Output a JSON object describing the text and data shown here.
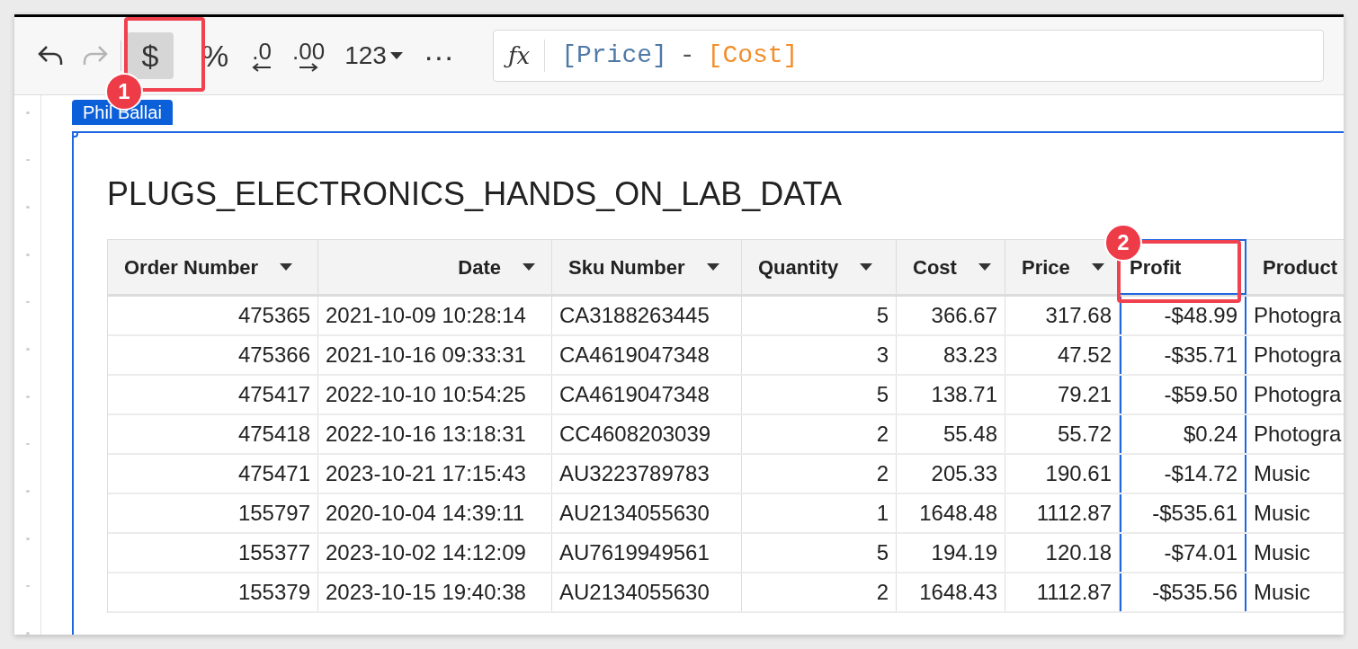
{
  "toolbar": {
    "buttons": [
      {
        "kind": "undo",
        "disabled": false,
        "selected": false
      },
      {
        "kind": "redo",
        "disabled": true,
        "selected": false
      },
      {
        "kind": "text",
        "label": "$",
        "disabled": false,
        "selected": true
      },
      {
        "kind": "text",
        "label": "%",
        "disabled": false,
        "selected": false
      },
      {
        "kind": "decrease_decimals",
        "label": ".0",
        "disabled": false,
        "selected": false
      },
      {
        "kind": "increase_decimals",
        "label": ".00",
        "disabled": false,
        "selected": false
      },
      {
        "kind": "dropdown",
        "label": "123",
        "disabled": false,
        "selected": false
      },
      {
        "kind": "text",
        "label": "···",
        "disabled": false,
        "selected": false
      }
    ],
    "function_label": "ƒx",
    "formula": [
      {
        "text": "[Price]",
        "color": "#4e79a7"
      },
      {
        "text": "-",
        "color": "#555555"
      },
      {
        "text": "[Cost]",
        "color": "#f28e2b"
      }
    ]
  },
  "user_tag": "Phil Ballai",
  "table": {
    "title": "PLUGS_ELECTRONICS_HANDS_ON_LAB_DATA",
    "columns": [
      {
        "label": "Order Number",
        "kind": "number",
        "dropdown": true,
        "editing": false,
        "selected": false
      },
      {
        "label": "Date",
        "kind": "datetime",
        "dropdown": true,
        "editing": false,
        "selected": false
      },
      {
        "label": "Sku Number",
        "kind": "text",
        "dropdown": true,
        "editing": false,
        "selected": false
      },
      {
        "label": "Quantity",
        "kind": "number",
        "dropdown": true,
        "editing": false,
        "selected": false
      },
      {
        "label": "Cost",
        "kind": "number",
        "dropdown": true,
        "editing": false,
        "selected": false
      },
      {
        "label": "Price",
        "kind": "number",
        "dropdown": true,
        "editing": false,
        "selected": false
      },
      {
        "label": "Profit",
        "kind": "number",
        "dropdown": false,
        "editing": true,
        "selected": true
      },
      {
        "label": "Product",
        "kind": "text",
        "editing": false,
        "selected": false
      }
    ],
    "rows": [
      [
        "475365",
        "2021-10-09 10:28:14",
        "CA3188263445",
        "5",
        "366.67",
        "317.68",
        "-$48.99",
        "Photogra"
      ],
      [
        "475366",
        "2021-10-16 09:33:31",
        "CA4619047348",
        "3",
        "83.23",
        "47.52",
        "-$35.71",
        "Photogra"
      ],
      [
        "475417",
        "2022-10-10 10:54:25",
        "CA4619047348",
        "5",
        "138.71",
        "79.21",
        "-$59.50",
        "Photogra"
      ],
      [
        "475418",
        "2022-10-16 13:18:31",
        "CC4608203039",
        "2",
        "55.48",
        "55.72",
        "$0.24",
        "Photogra"
      ],
      [
        "475471",
        "2023-10-21 17:15:43",
        "AU3223789783",
        "2",
        "205.33",
        "190.61",
        "-$14.72",
        "Music"
      ],
      [
        "155797",
        "2020-10-04 14:39:11",
        "AU2134055630",
        "1",
        "1648.48",
        "1112.87",
        "-$535.61",
        "Music"
      ],
      [
        "155377",
        "2023-10-02 14:12:09",
        "AU7619949561",
        "5",
        "194.19",
        "120.18",
        "-$74.01",
        "Music"
      ],
      [
        "155379",
        "2023-10-15 19:40:38",
        "AU2134055630",
        "2",
        "1648.43",
        "1112.87",
        "-$535.56",
        "Music"
      ]
    ]
  },
  "callouts": [
    {
      "number": "1"
    },
    {
      "number": "2"
    }
  ]
}
